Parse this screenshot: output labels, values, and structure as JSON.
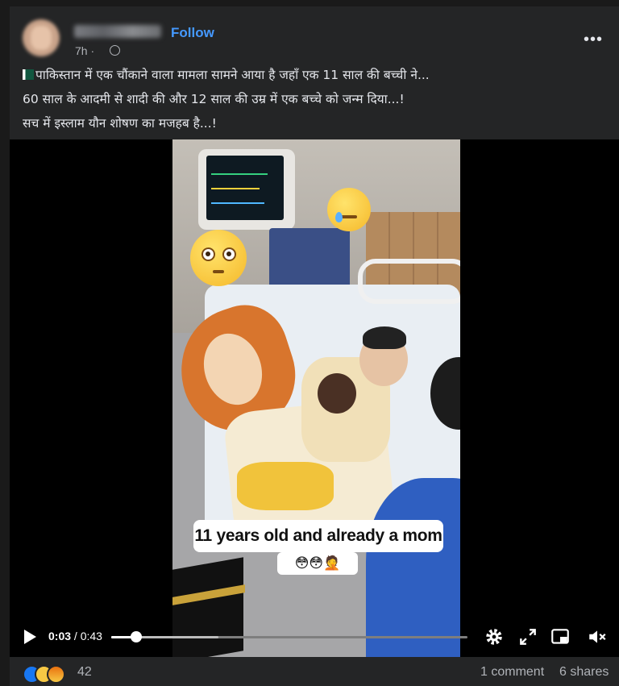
{
  "post": {
    "follow_label": "Follow",
    "time": "7h ·",
    "more_label": "•••",
    "text_lines": [
      "पाकिस्तान में एक चौंकाने वाला मामला सामने आया है जहाँ एक 11 साल की बच्ची ने...",
      "60 साल के आदमी से शादी की और 12 साल की उम्र में एक बच्चे को जन्म दिया...!",
      "सच में इस्लाम यौन शोषण का मजहब है...!"
    ]
  },
  "video": {
    "caption": "11 years old and already a mom",
    "caption_emojis": "😳😳🤦",
    "current_time": "0:03",
    "duration": "/ 0:43",
    "progress_fraction": 0.07
  },
  "footer": {
    "reaction_count": "42",
    "comments": "1 comment",
    "shares": "6 shares"
  },
  "icons": {
    "reactions": [
      "like-icon",
      "sad-icon",
      "angry-icon"
    ],
    "controls": [
      "play-icon",
      "settings-icon",
      "fullscreen-icon",
      "picture-in-picture-icon",
      "mute-icon"
    ]
  },
  "colors": {
    "follow": "#4599ff",
    "card_bg": "#242526",
    "like": "#1877f2"
  }
}
